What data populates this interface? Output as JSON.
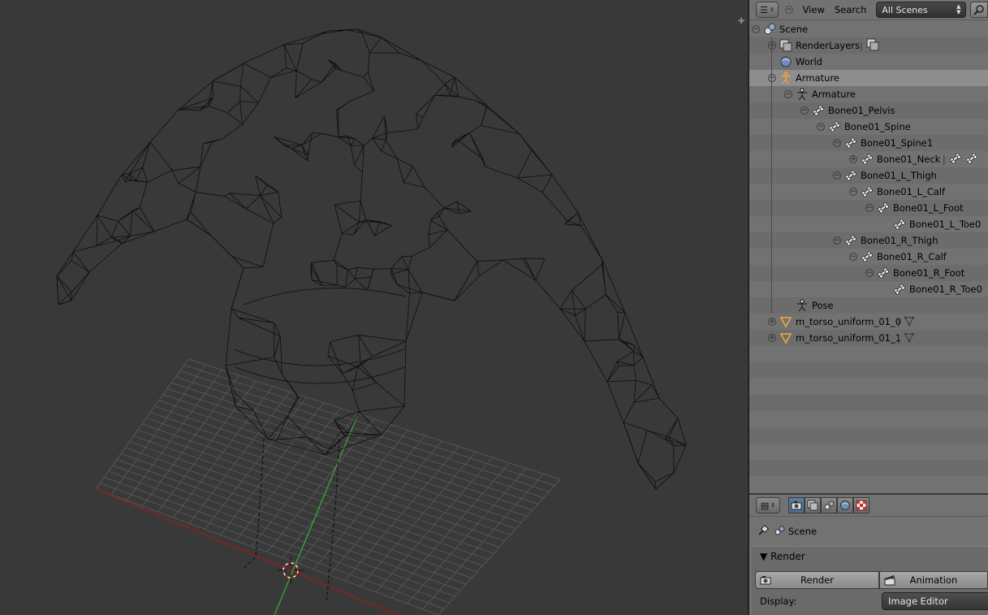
{
  "outliner": {
    "header": {
      "menu_view": "View",
      "menu_search": "Search",
      "display_mode": "All Scenes"
    },
    "rows": [
      {
        "label": "Scene",
        "icon": "scene-icon",
        "expand": "−"
      },
      {
        "label": "RenderLayers",
        "icon": "renderlayers-icon",
        "expand": "+"
      },
      {
        "label": "World",
        "icon": "world-icon",
        "expand": ""
      },
      {
        "label": "Armature",
        "icon": "armature-object-icon",
        "expand": "−"
      },
      {
        "label": "Armature",
        "icon": "armature-data-icon",
        "expand": "−"
      },
      {
        "label": "Bone01_Pelvis",
        "icon": "bone-icon",
        "expand": "−"
      },
      {
        "label": "Bone01_Spine",
        "icon": "bone-icon",
        "expand": "−"
      },
      {
        "label": "Bone01_Spine1",
        "icon": "bone-icon",
        "expand": "−"
      },
      {
        "label": "Bone01_Neck",
        "icon": "bone-icon",
        "expand": "+"
      },
      {
        "label": "Bone01_L_Thigh",
        "icon": "bone-icon",
        "expand": "−"
      },
      {
        "label": "Bone01_L_Calf",
        "icon": "bone-icon",
        "expand": "−"
      },
      {
        "label": "Bone01_L_Foot",
        "icon": "bone-icon",
        "expand": "−"
      },
      {
        "label": "Bone01_L_Toe0",
        "icon": "bone-icon",
        "expand": ""
      },
      {
        "label": "Bone01_R_Thigh",
        "icon": "bone-icon",
        "expand": "−"
      },
      {
        "label": "Bone01_R_Calf",
        "icon": "bone-icon",
        "expand": "−"
      },
      {
        "label": "Bone01_R_Foot",
        "icon": "bone-icon",
        "expand": "−"
      },
      {
        "label": "Bone01_R_Toe0",
        "icon": "bone-icon",
        "expand": ""
      },
      {
        "label": "Pose",
        "icon": "pose-icon",
        "expand": ""
      },
      {
        "label": "m_torso_uniform_01_0",
        "icon": "mesh-object-icon",
        "expand": "+"
      },
      {
        "label": "m_torso_uniform_01_1",
        "icon": "mesh-object-icon",
        "expand": "+"
      }
    ]
  },
  "properties": {
    "scene_path": "Scene",
    "render_panel": {
      "title": "Render",
      "render_button": "Render",
      "animation_button": "Animation",
      "display_label": "Display:",
      "display_value": "Image Editor"
    }
  },
  "colors": {
    "viewport_bg": "#393939",
    "panel_bg": "#727272",
    "selected_row": "#8d8d8d",
    "x_axis": "#a02020",
    "y_axis": "#3aa03a",
    "armature_orange": "#e8a040"
  }
}
